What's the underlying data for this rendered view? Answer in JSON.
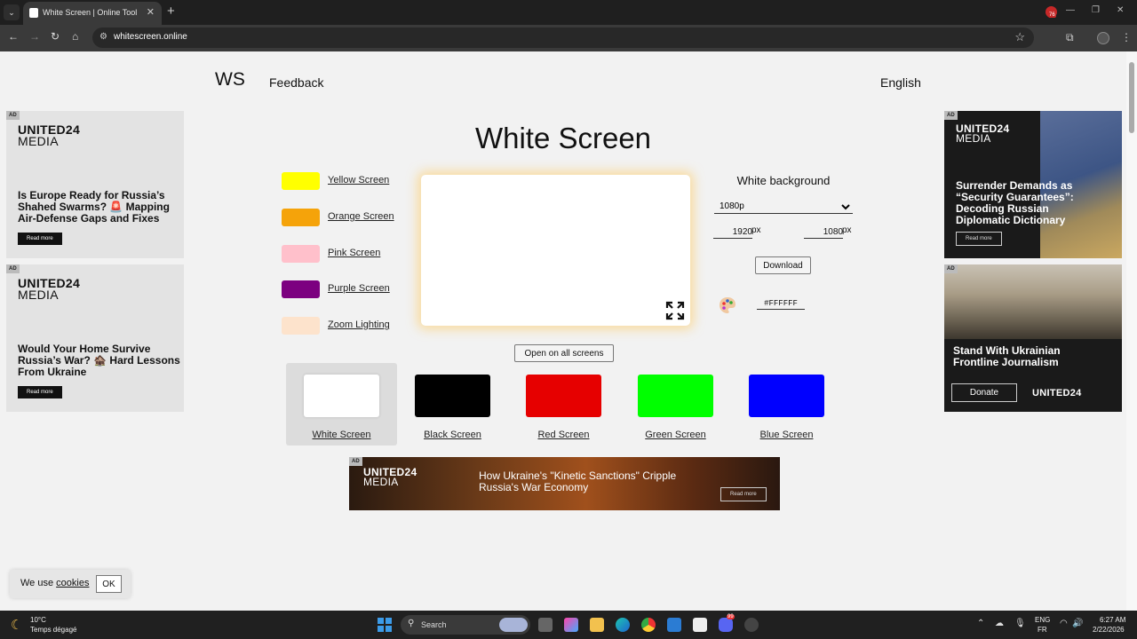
{
  "browser": {
    "tab_title": "White Screen | Online Tool",
    "url": "whitescreen.online",
    "extension_badge": "76"
  },
  "header": {
    "logo": "WS",
    "feedback": "Feedback",
    "language": "English"
  },
  "title": "White Screen",
  "color_options": [
    {
      "label": "Yellow Screen",
      "color": "#ffff00"
    },
    {
      "label": "Orange Screen",
      "color": "#f5a30a"
    },
    {
      "label": "Pink Screen",
      "color": "#ffc0cb"
    },
    {
      "label": "Purple Screen",
      "color": "#7c0080"
    },
    {
      "label": "Zoom Lighting",
      "color": "#fde3cc"
    }
  ],
  "settings": {
    "heading": "White background",
    "resolution": "1080p",
    "width": "1920",
    "height": "1080",
    "unit": "px",
    "download": "Download",
    "hex": "#FFFFFF"
  },
  "open_all": "Open on all screens",
  "presets": [
    {
      "label": "White Screen",
      "color": "#ffffff",
      "selected": true
    },
    {
      "label": "Black Screen",
      "color": "#000000",
      "selected": false
    },
    {
      "label": "Red Screen",
      "color": "#e60000",
      "selected": false
    },
    {
      "label": "Green Screen",
      "color": "#00ff00",
      "selected": false
    },
    {
      "label": "Blue Screen",
      "color": "#0000ff",
      "selected": false
    }
  ],
  "ads": {
    "tag": "AD",
    "brand_line1": "UNITED24",
    "brand_line2": "MEDIA",
    "left_top": {
      "headline": "Is Europe Ready for Russia’s Shahed Swarms? 🚨 Mapping Air-Defense Gaps and Fixes",
      "cta": "Read more"
    },
    "left_bottom": {
      "headline": "Would Your Home Survive Russia’s War? 🏚️ Hard Lessons From Ukraine",
      "cta": "Read more"
    },
    "right_top": {
      "headline": "Surrender Demands as “Security Guarantees”: Decoding Russian Diplomatic Dictionary",
      "cta": "Read more"
    },
    "right_bottom": {
      "headline": "Stand With Ukrainian Frontline Journalism",
      "cta": "Donate",
      "brand": "UNITED24"
    },
    "banner": {
      "headline": "How Ukraine's \"Kinetic Sanctions\" Cripple Russia's War Economy",
      "cta": "Read more"
    }
  },
  "cookie": {
    "text": "We use",
    "link": "cookies",
    "ok": "OK"
  },
  "taskbar": {
    "temperature": "10°C",
    "weather": "Temps dégagé",
    "search": "Search",
    "lang": "ENG",
    "region": "FR",
    "time": "6:27 AM",
    "date": "2/22/2026",
    "discord_badge": "99"
  }
}
